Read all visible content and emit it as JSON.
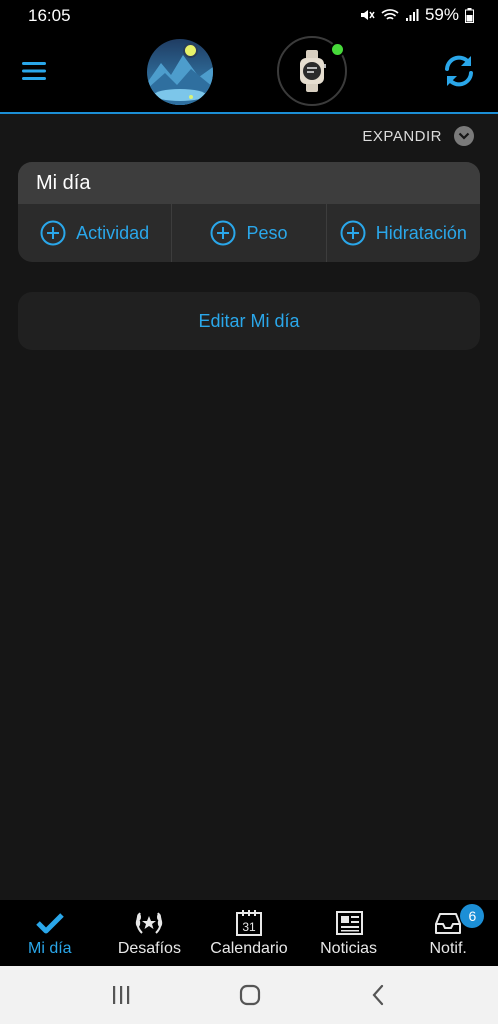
{
  "status": {
    "time": "16:05",
    "battery": "59%"
  },
  "header": {
    "menu_icon": "hamburger-icon",
    "sync_icon": "sync-icon"
  },
  "expand": {
    "label": "EXPANDIR"
  },
  "my_day": {
    "title": "Mi día",
    "actions": [
      {
        "label": "Actividad",
        "icon": "plus-circle-icon"
      },
      {
        "label": "Peso",
        "icon": "plus-circle-icon"
      },
      {
        "label": "Hidratación",
        "icon": "plus-circle-icon"
      }
    ]
  },
  "edit": {
    "label": "Editar Mi día"
  },
  "tabs": [
    {
      "label": "Mi día",
      "icon": "check-icon",
      "active": true
    },
    {
      "label": "Desafíos",
      "icon": "laurel-icon"
    },
    {
      "label": "Calendario",
      "icon": "calendar-icon",
      "icon_text": "31"
    },
    {
      "label": "Noticias",
      "icon": "newspaper-icon"
    },
    {
      "label": "Notif.",
      "icon": "inbox-icon",
      "badge": "6"
    }
  ],
  "colors": {
    "accent": "#2aa7ea",
    "background": "#161616"
  }
}
